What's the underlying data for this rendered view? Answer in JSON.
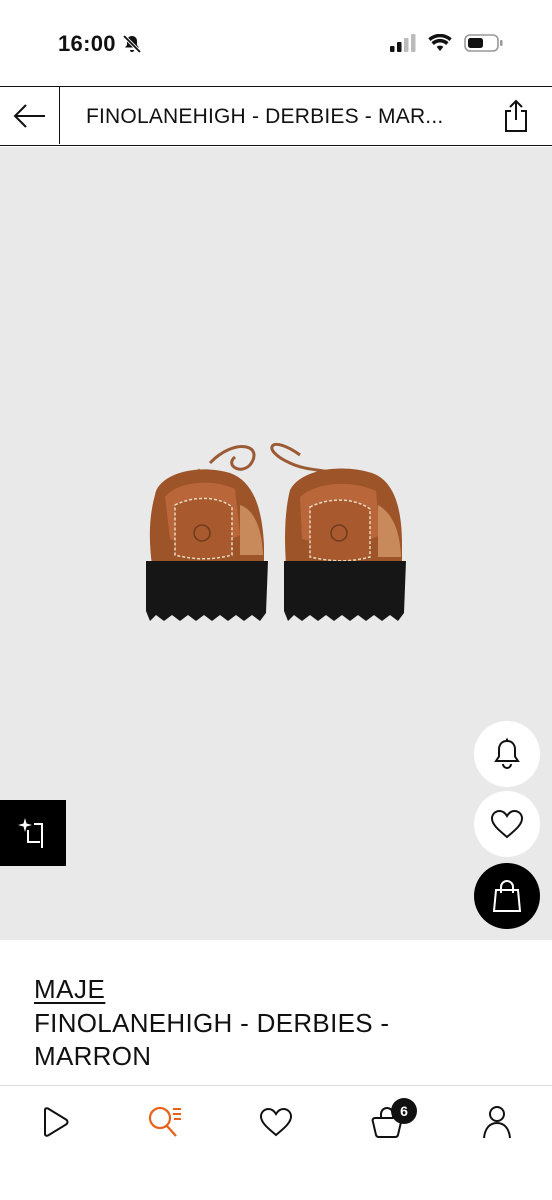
{
  "status_bar": {
    "time": "16:00",
    "icons": [
      "bell-slash-icon",
      "signal-icon",
      "wifi-icon",
      "battery-icon"
    ]
  },
  "header": {
    "title": "FINOLANEHIGH - DERBIES - MAR...",
    "back_icon": "arrow-left-icon",
    "share_icon": "share-icon"
  },
  "gallery": {
    "image_alt": "brown leather derby shoes with black lug sole",
    "actions": [
      "bell-icon",
      "heart-icon",
      "shopping-bag-icon"
    ],
    "ai_button_icon": "sparkle-crop-icon"
  },
  "product": {
    "brand": "MAJE",
    "name": "FINOLANEHIGH - DERBIES - MARRON"
  },
  "bottom_nav": {
    "items": [
      {
        "icon": "play-icon"
      },
      {
        "icon": "search-list-icon",
        "active": true
      },
      {
        "icon": "heart-icon"
      },
      {
        "icon": "basket-icon",
        "badge": "6"
      },
      {
        "icon": "user-icon"
      }
    ]
  },
  "colors": {
    "accent": "#e8611a",
    "text": "#111111",
    "image_bg": "#e9e9e9"
  }
}
